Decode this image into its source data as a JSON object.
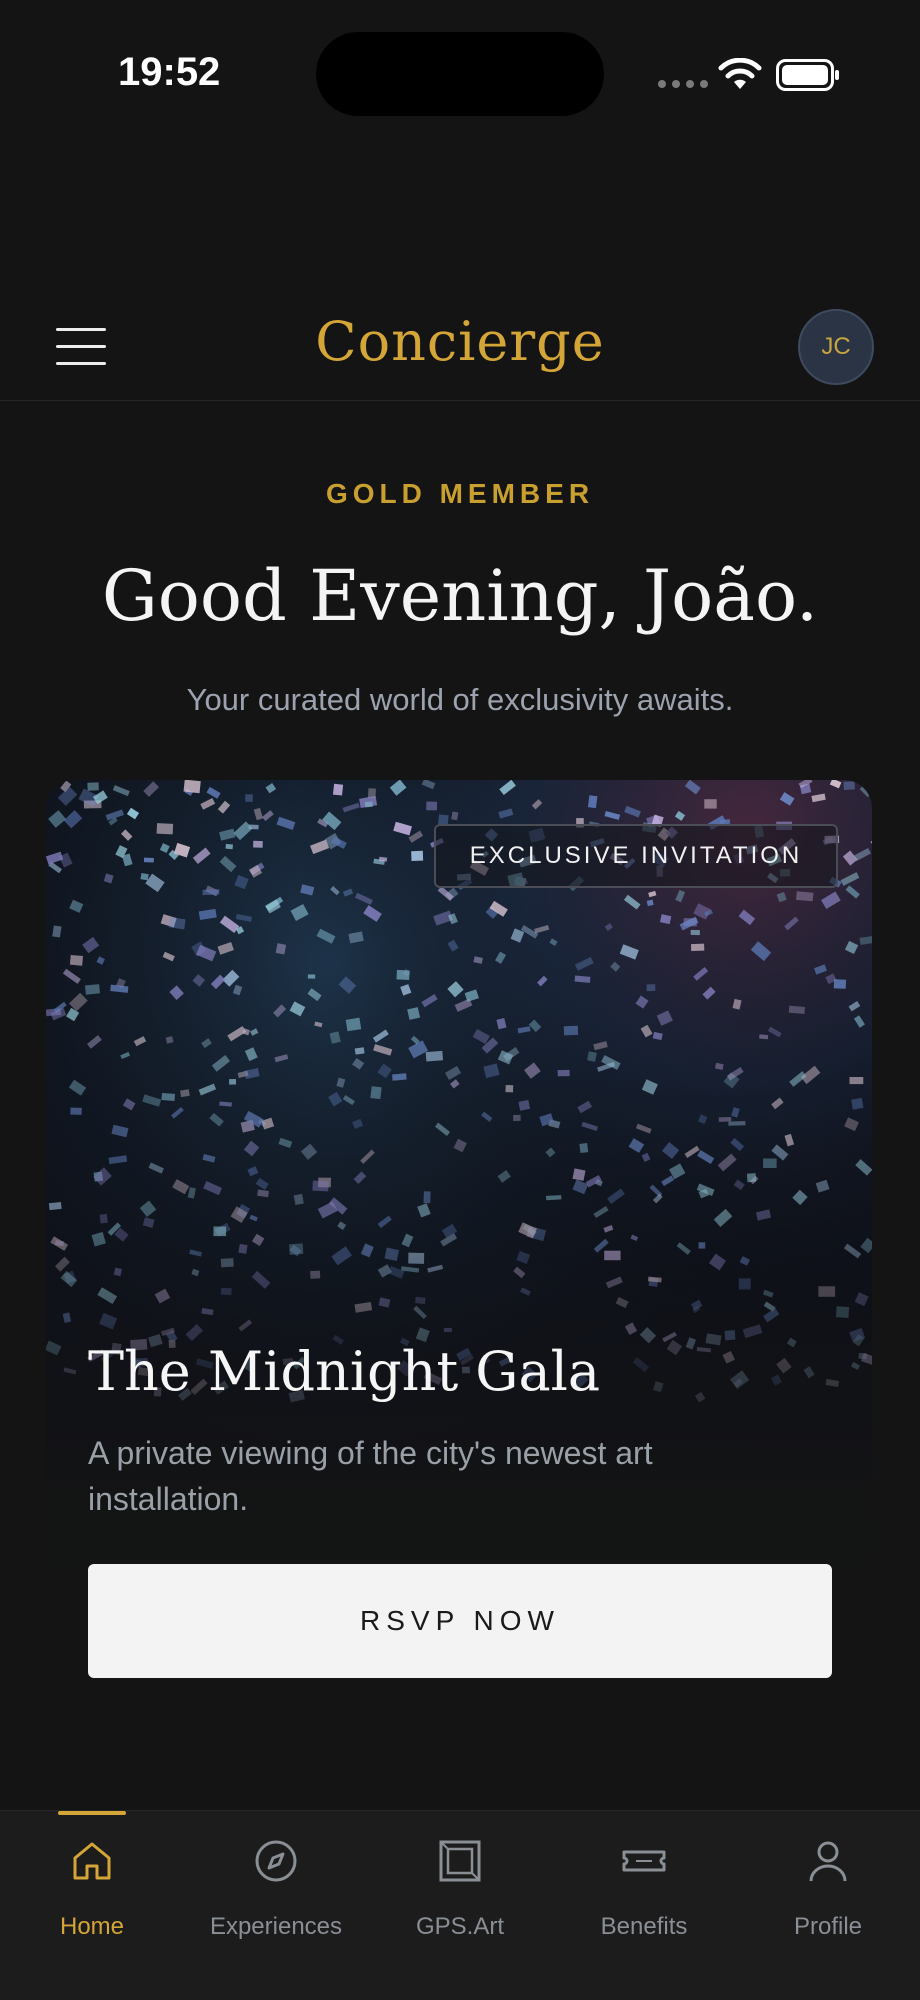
{
  "status_bar": {
    "time": "19:52"
  },
  "header": {
    "brand": "Concierge",
    "avatar_initials": "JC"
  },
  "greeting": {
    "tier": "GOLD MEMBER",
    "title": "Good Evening, João.",
    "subtitle": "Your curated world of exclusivity awaits."
  },
  "featured": {
    "badge": "EXCLUSIVE INVITATION",
    "title": "The Midnight Gala",
    "description": "A private viewing of the city's newest art installation.",
    "cta": "RSVP NOW"
  },
  "tabs": [
    {
      "label": "Home",
      "icon": "home-icon",
      "active": true
    },
    {
      "label": "Experiences",
      "icon": "compass-icon",
      "active": false
    },
    {
      "label": "GPS.Art",
      "icon": "frame-icon",
      "active": false
    },
    {
      "label": "Benefits",
      "icon": "ticket-icon",
      "active": false
    },
    {
      "label": "Profile",
      "icon": "person-icon",
      "active": false
    }
  ],
  "colors": {
    "accent": "#d4a537",
    "background": "#141414",
    "tab_bar": "#1c1c1c"
  }
}
